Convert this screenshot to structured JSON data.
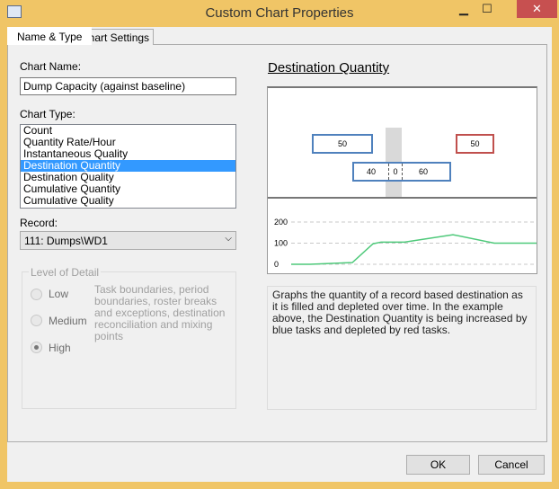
{
  "window": {
    "title": "Custom Chart Properties",
    "minimize": "▁",
    "maximize": "☐",
    "close": "✕"
  },
  "tabs": [
    {
      "label": "Name & Type",
      "active": true
    },
    {
      "label": "Chart Settings",
      "active": false
    }
  ],
  "form": {
    "chart_name_label": "Chart Name:",
    "chart_name_value": "Dump Capacity (against baseline)",
    "chart_type_label": "Chart Type:",
    "chart_types": [
      "Count",
      "Quantity Rate/Hour",
      "Instantaneous Quality",
      "Destination Quantity",
      "Destination Quality",
      "Cumulative Quantity",
      "Cumulative Quality"
    ],
    "selected_chart_type": "Destination Quantity",
    "record_label": "Record:",
    "record_value": "111: Dumps\\WD1",
    "level_of_detail": {
      "title": "Level of Detail",
      "options": [
        "Low",
        "Medium",
        "High"
      ],
      "selected": "High",
      "description": "Task boundaries, period boundaries, roster breaks and exceptions, destination reconciliation and mixing points"
    }
  },
  "preview": {
    "title": "Destination Quantity",
    "tasks": {
      "blue_top": "50",
      "red": "50",
      "blue_split": [
        "40",
        "0",
        "60"
      ]
    },
    "description": "Graphs the quantity of a record based destination as it is filled and depleted over time. In the example above, the Destination Quantity is being increased by blue tasks and depleted by red tasks."
  },
  "chart_data": {
    "type": "line",
    "y_ticks": [
      "200",
      "100",
      "0"
    ],
    "ylim": [
      0,
      200
    ],
    "values": [
      0,
      0,
      8,
      97,
      105,
      105,
      140,
      100,
      100
    ],
    "color": "#4ec97a"
  },
  "buttons": {
    "ok": "OK",
    "cancel": "Cancel"
  }
}
